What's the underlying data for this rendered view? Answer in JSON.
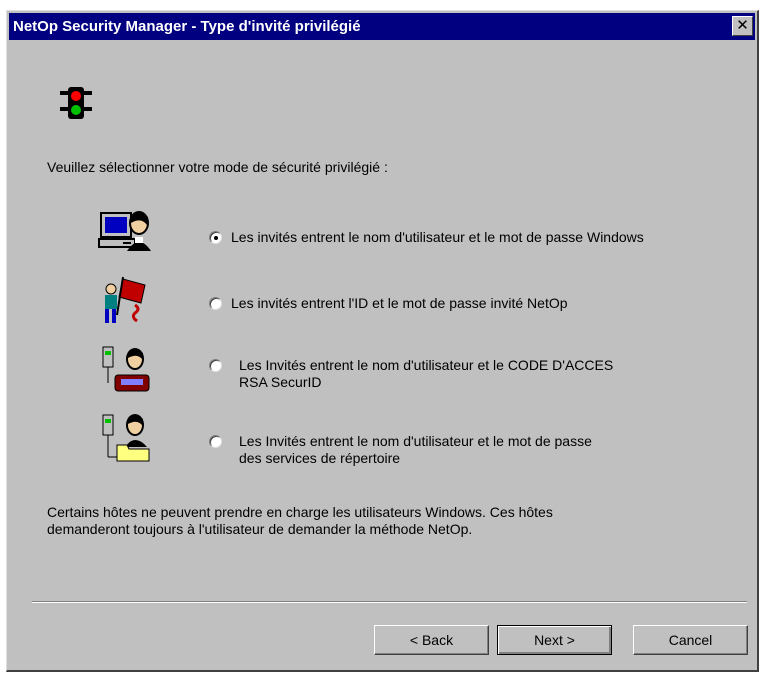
{
  "window": {
    "title": "NetOp Security Manager - Type d'invité privilégié",
    "close_glyph": "✕"
  },
  "prompt": "Veuillez sélectionner votre mode de sécurité privilégié :",
  "options": [
    {
      "icon": "windows-user-icon",
      "label_lines": [
        "Les invités entrent le nom d'utilisateur et le mot de passe Windows"
      ],
      "checked": true
    },
    {
      "icon": "netop-guest-icon",
      "label_lines": [
        "Les invités entrent l'ID et le mot de passe invité NetOp"
      ],
      "checked": false
    },
    {
      "icon": "securid-user-icon",
      "label_lines": [
        "Les Invités entrent le nom d'utilisateur et le CODE D'ACCES",
        "RSA SecurID"
      ],
      "checked": false
    },
    {
      "icon": "directory-services-icon",
      "label_lines": [
        "Les Invités entrent le nom d'utilisateur et le mot de passe",
        "des services de répertoire"
      ],
      "checked": false
    }
  ],
  "note_lines": [
    "Certains hôtes ne peuvent prendre en charge les utilisateurs Windows. Ces hôtes",
    "demanderont toujours à l'utilisateur de demander la méthode NetOp."
  ],
  "buttons": {
    "back": "< Back",
    "next": "Next >",
    "cancel": "Cancel"
  },
  "colors": {
    "titlebar": "#000080",
    "dialog_face": "#c0c0c0"
  }
}
